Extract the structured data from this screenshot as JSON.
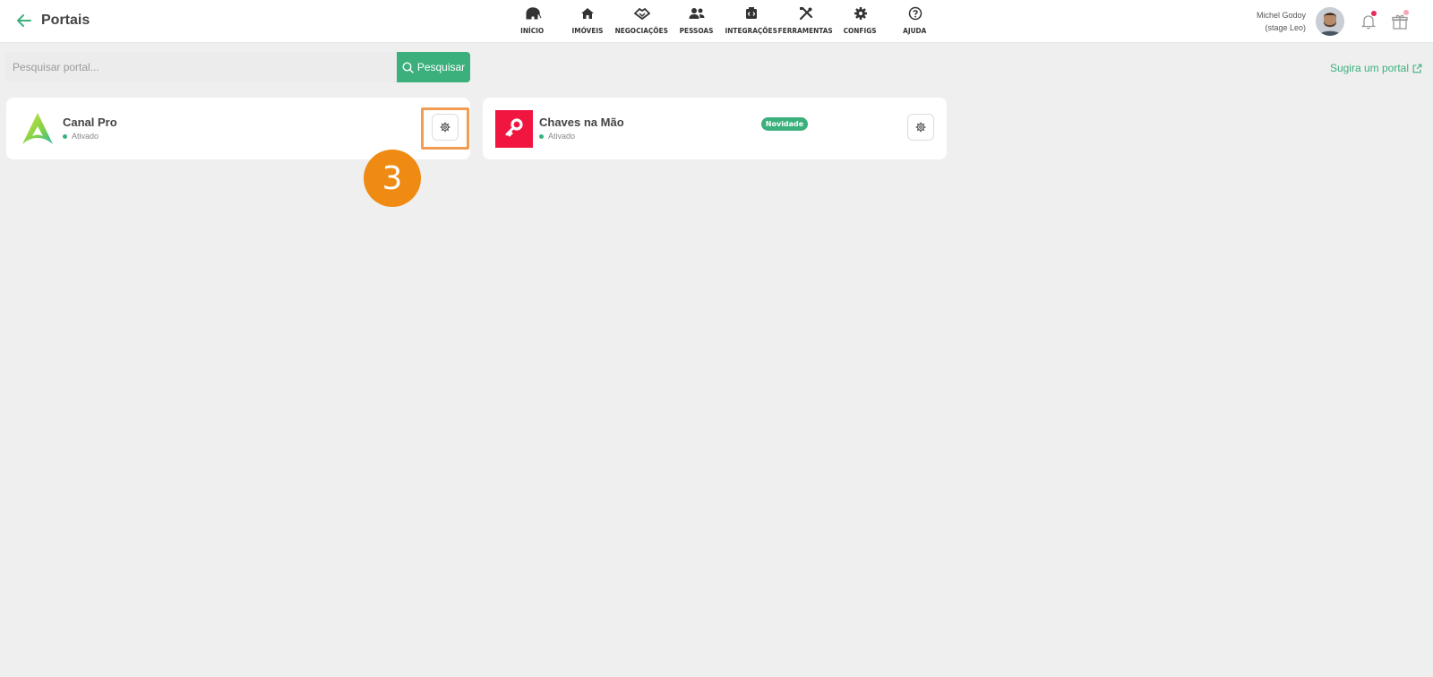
{
  "header": {
    "title": "Portais",
    "nav": [
      {
        "label": "INÍCIO",
        "icon": "elephant-icon"
      },
      {
        "label": "IMÓVEIS",
        "icon": "house-icon"
      },
      {
        "label": "NEGOCIAÇÕES",
        "icon": "handshake-icon"
      },
      {
        "label": "PESSOAS",
        "icon": "people-icon"
      },
      {
        "label": "INTEGRAÇÕES",
        "icon": "integration-icon"
      },
      {
        "label": "FERRAMENTAS",
        "icon": "tools-icon"
      },
      {
        "label": "CONFIGS",
        "icon": "gear-icon"
      },
      {
        "label": "AJUDA",
        "icon": "help-icon"
      }
    ],
    "user": {
      "name": "Michel Godoy",
      "context": "(stage Leo)"
    }
  },
  "search": {
    "placeholder": "Pesquisar portal...",
    "value": "",
    "button_label": "Pesquisar"
  },
  "suggest_link": "Sugira um portal",
  "portals": [
    {
      "name": "Canal Pro",
      "status": "Ativado",
      "badge": ""
    },
    {
      "name": "Chaves na Mão",
      "status": "Ativado",
      "badge": "Novidade"
    }
  ],
  "step_marker": "3",
  "colors": {
    "accent": "#3bb07c",
    "highlight": "#f29b53",
    "step": "#ef8a12",
    "chaves_brand": "#f0163f"
  }
}
